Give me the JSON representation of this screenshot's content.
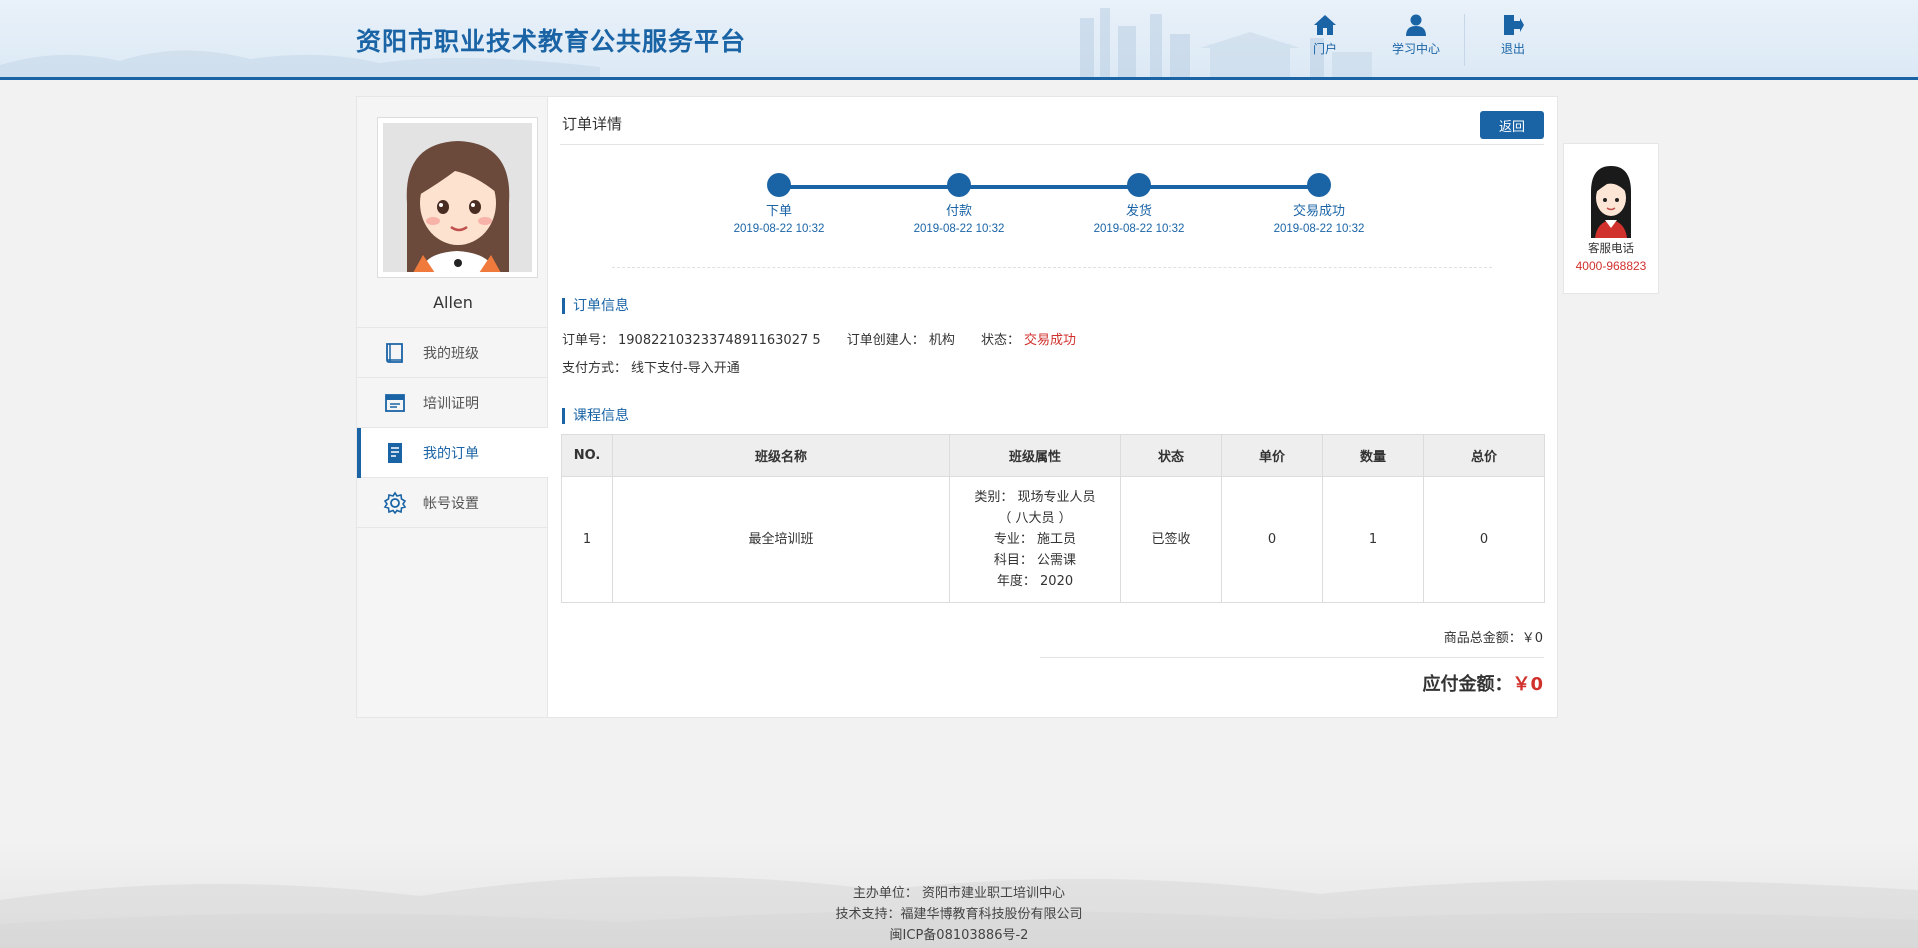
{
  "header": {
    "site_title": "资阳市职业技术教育公共服务平台",
    "nav": [
      {
        "label": "门户",
        "icon": "home-icon"
      },
      {
        "label": "学习中心",
        "icon": "user-icon"
      },
      {
        "label": "退出",
        "icon": "logout-icon"
      }
    ]
  },
  "sidebar": {
    "username": "Allen",
    "avatar_icon": "avatar-girl",
    "menu": [
      {
        "label": "我的班级",
        "icon": "book-icon",
        "active": false
      },
      {
        "label": "培训证明",
        "icon": "certificate-icon",
        "active": false
      },
      {
        "label": "我的订单",
        "icon": "document-icon",
        "active": true
      },
      {
        "label": "帐号设置",
        "icon": "gear-icon",
        "active": false
      }
    ]
  },
  "main": {
    "title": "订单详情",
    "back_label": "返回",
    "steps": [
      {
        "label": "下单",
        "time": "2019-08-22 10:32"
      },
      {
        "label": "付款",
        "time": "2019-08-22 10:32"
      },
      {
        "label": "发货",
        "time": "2019-08-22 10:32"
      },
      {
        "label": "交易成功",
        "time": "2019-08-22 10:32"
      }
    ],
    "order_info": {
      "section_title": "订单信息",
      "order_no_label": "订单号：",
      "order_no": "19082210323374891163027 5",
      "creator_label": "订单创建人：",
      "creator": "机构",
      "status_label": "状态：",
      "status": "交易成功",
      "pay_label": "支付方式：",
      "pay_method": "线下支付-导入开通"
    },
    "course_info": {
      "section_title": "课程信息",
      "headers": [
        "NO.",
        "班级名称",
        "班级属性",
        "状态",
        "单价",
        "数量",
        "总价"
      ],
      "rows": [
        {
          "no": "1",
          "class_name": "最全培训班",
          "attrs": [
            "类别： 现场专业人员",
            "（ 八大员 ）",
            "专业： 施工员",
            "科目： 公需课",
            "年度： 2020"
          ],
          "status": "已签收",
          "unit_price": "0",
          "quantity": "1",
          "total": "0"
        }
      ]
    },
    "subtotal_label": "商品总金额：",
    "subtotal": "￥0",
    "payable_label": "应付金额：",
    "payable": "￥0"
  },
  "service": {
    "label": "客服电话",
    "phone": "4000-968823"
  },
  "footer": {
    "host": "主办单位： 资阳市建业职工培训中心",
    "support": "技术支持：福建华博教育科技股份有限公司",
    "icp": "闽ICP备08103886号-2"
  },
  "colors": {
    "brand": "#1a64a6",
    "danger": "#d0312d"
  }
}
